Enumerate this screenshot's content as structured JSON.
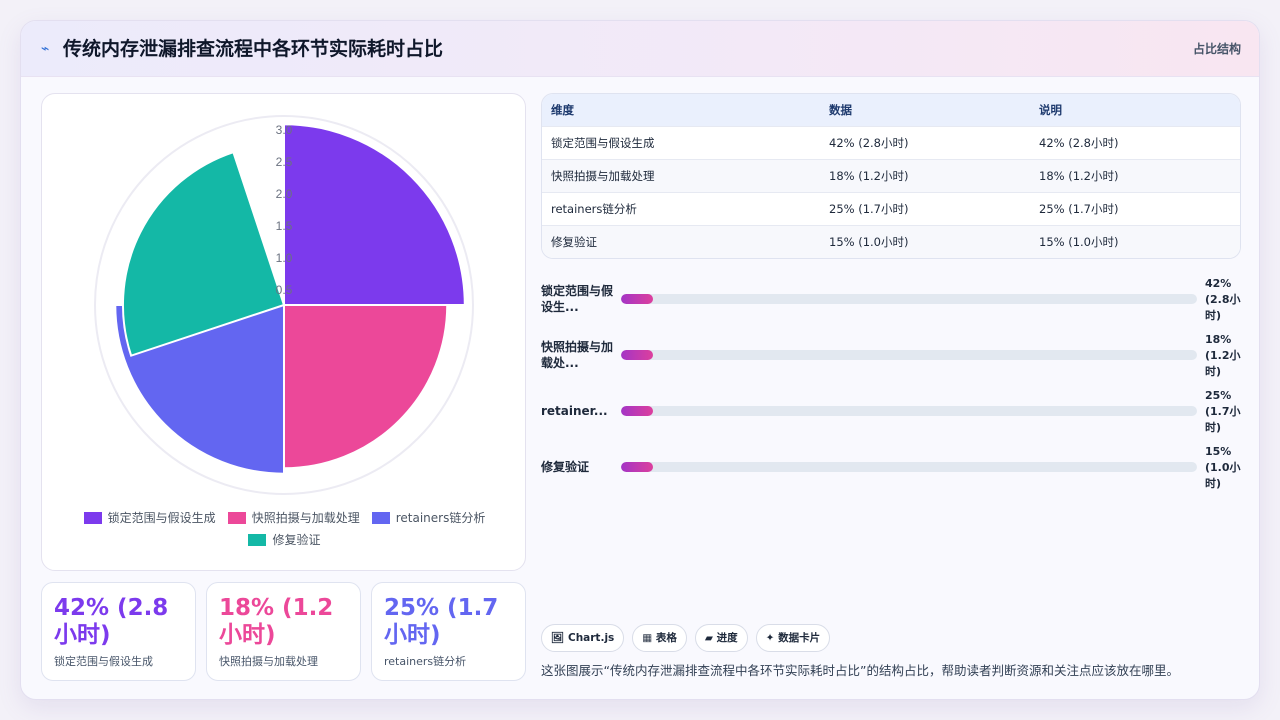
{
  "header": {
    "icon": "wave-icon",
    "title": "传统内存泄漏排查流程中各环节实际耗时占比",
    "tag": "占比结构"
  },
  "chart_data": {
    "type": "pie",
    "title": "",
    "categories": [
      "锁定范围与假设生成",
      "快照拍摄与加载处理",
      "retainers链分析",
      "修复验证"
    ],
    "values": [
      2.8,
      1.2,
      1.7,
      1.0
    ],
    "colors": [
      "#7c3aed",
      "#ec4899",
      "#6366f1",
      "#14b8a6"
    ],
    "radial_ticks": [
      "3.0",
      "2.5",
      "2.0",
      "1.5",
      "1.0",
      "0.5"
    ],
    "radial_range": [
      0,
      3.0
    ],
    "legend_position": "bottom"
  },
  "kpis": [
    {
      "value": "42% (2.8小时)",
      "label": "锁定范围与假设生成",
      "color": "#7c3aed"
    },
    {
      "value": "18% (1.2小时)",
      "label": "快照拍摄与加载处理",
      "color": "#ec4899"
    },
    {
      "value": "25% (1.7小时)",
      "label": "retainers链分析",
      "color": "#6366f1"
    }
  ],
  "table": {
    "headers": [
      "维度",
      "数据",
      "说明"
    ],
    "rows": [
      [
        "锁定范围与假设生成",
        "42% (2.8小时)",
        "42% (2.8小时)"
      ],
      [
        "快照拍摄与加载处理",
        "18% (1.2小时)",
        "18% (1.2小时)"
      ],
      [
        "retainers链分析",
        "25% (1.7小时)",
        "25% (1.7小时)"
      ],
      [
        "修复验证",
        "15% (1.0小时)",
        "15% (1.0小时)"
      ]
    ]
  },
  "progress": [
    {
      "label": "锁定范围与假设生成",
      "display_label": "锁定范围与假设生...",
      "value_text": "42% (2.8小时)",
      "fill_fraction": 0.055
    },
    {
      "label": "快照拍摄与加载处理",
      "display_label": "快照拍摄与加载处...",
      "value_text": "18% (1.2小时)",
      "fill_fraction": 0.055
    },
    {
      "label": "retainers链分析",
      "display_label": "retainer...",
      "value_text": "25% (1.7小时)",
      "fill_fraction": 0.055
    },
    {
      "label": "修复验证",
      "display_label": "修复验证",
      "value_text": "15% (1.0小时)",
      "fill_fraction": 0.055
    }
  ],
  "chips": [
    {
      "icon": "image-icon",
      "label": "🖼 Chart.js"
    },
    {
      "icon": "table-icon",
      "label": "▦ 表格"
    },
    {
      "icon": "progress-icon",
      "label": "▰ 进度"
    },
    {
      "icon": "sparkle-icon",
      "label": "✦ 数据卡片"
    }
  ],
  "description": "这张图展示“传统内存泄漏排查流程中各环节实际耗时占比”的结构占比，帮助读者判断资源和关注点应该放在哪里。"
}
